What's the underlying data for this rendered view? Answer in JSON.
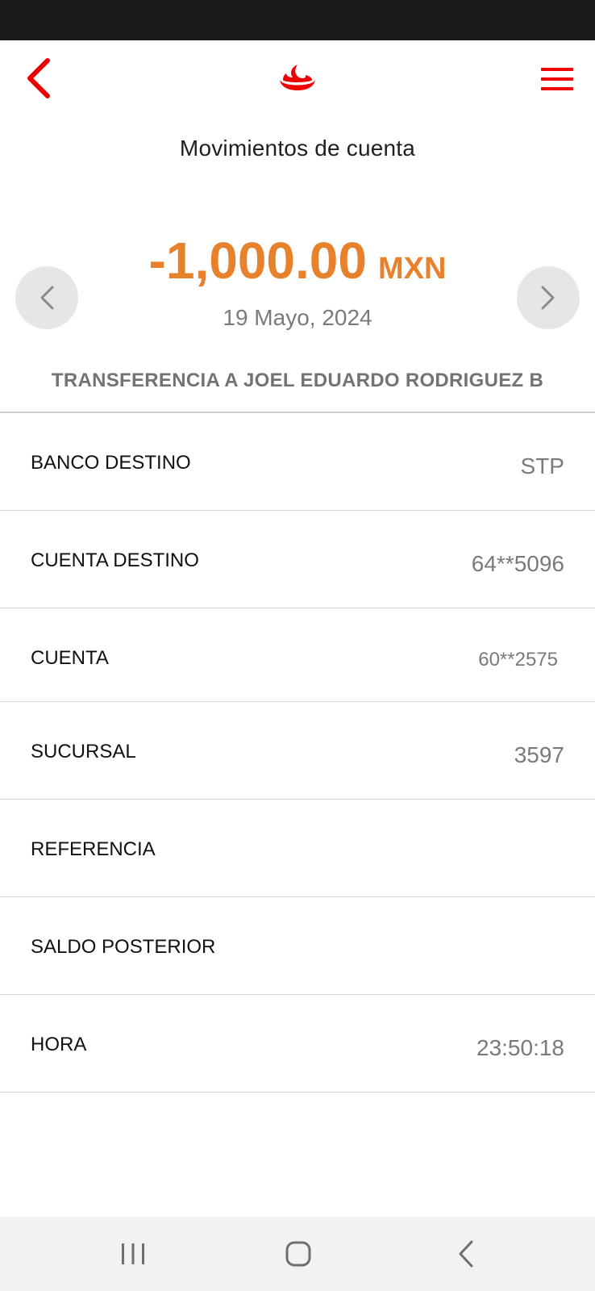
{
  "header": {
    "title": "Movimientos de cuenta"
  },
  "transaction": {
    "amount": "-1,000.00",
    "currency": "MXN",
    "date": "19 Mayo, 2024",
    "description": "TRANSFERENCIA A JOEL EDUARDO RODRIGUEZ B"
  },
  "details": [
    {
      "label": "BANCO DESTINO",
      "value": "STP"
    },
    {
      "label": "CUENTA DESTINO",
      "value": "64**5096"
    },
    {
      "label": "CUENTA",
      "value": "60**2575"
    },
    {
      "label": "SUCURSAL",
      "value": "3597"
    },
    {
      "label": "REFERENCIA",
      "value": ""
    },
    {
      "label": "SALDO POSTERIOR",
      "value": ""
    },
    {
      "label": "HORA",
      "value": "23:50:18"
    }
  ],
  "icons": {
    "back": "chevron-left-icon",
    "logo": "santander-flame-logo",
    "menu": "hamburger-menu-icon",
    "prev": "chevron-left-icon",
    "next": "chevron-right-icon"
  },
  "colors": {
    "brand_red": "#ec0000",
    "amount_orange": "#e8812b",
    "status_bar": "#1b1b1b",
    "nav_bar": "#f2f2f4"
  }
}
